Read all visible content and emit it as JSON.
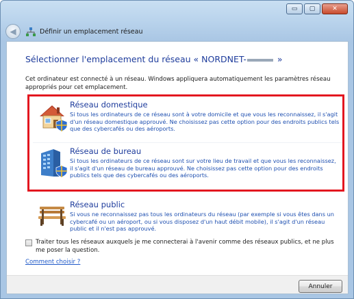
{
  "window": {
    "minimize_glyph": "▭",
    "maximize_glyph": "▢",
    "close_glyph": "✕"
  },
  "nav": {
    "title": "Définir un emplacement réseau"
  },
  "main": {
    "heading_prefix": "Sélectionner l'emplacement du réseau « NORDNET-",
    "heading_suffix": " »",
    "intro": "Cet ordinateur est connecté à un réseau. Windows appliquera automatiquement les paramètres réseau appropriés pour cet emplacement."
  },
  "options": [
    {
      "icon": "house-icon",
      "title": "Réseau domestique",
      "description": "Si tous les ordinateurs de ce réseau sont à votre domicile et que vous les reconnaissez, il s'agit d'un réseau domestique approuvé. Ne choisissez pas cette option pour des endroits publics tels que des cybercafés ou des aéroports."
    },
    {
      "icon": "office-building-icon",
      "title": "Réseau de bureau",
      "description": "Si tous les ordinateurs de ce réseau sont sur votre lieu de travail et que vous les reconnaissez, il s'agit d'un réseau de bureau approuvé. Ne choisissez pas cette option pour des endroits publics tels que des cybercafés ou des aéroports."
    },
    {
      "icon": "park-bench-icon",
      "title": "Réseau public",
      "description": "Si vous ne reconnaissez pas tous les ordinateurs du réseau (par exemple si vous êtes dans un cybercafé ou un aéroport, ou si vous disposez d'un haut débit mobile), il s'agit d'un réseau public et il n'est pas approuvé."
    }
  ],
  "checkbox": {
    "label": "Traiter tous les réseaux auxquels je me connecterai à l'avenir comme des réseaux publics, et ne plus me poser la question.",
    "checked": false
  },
  "help_link": "Comment choisir ?",
  "footer": {
    "cancel_label": "Annuler"
  },
  "colors": {
    "accent_blue": "#1e3c9c",
    "highlight_red": "#e3161f"
  }
}
